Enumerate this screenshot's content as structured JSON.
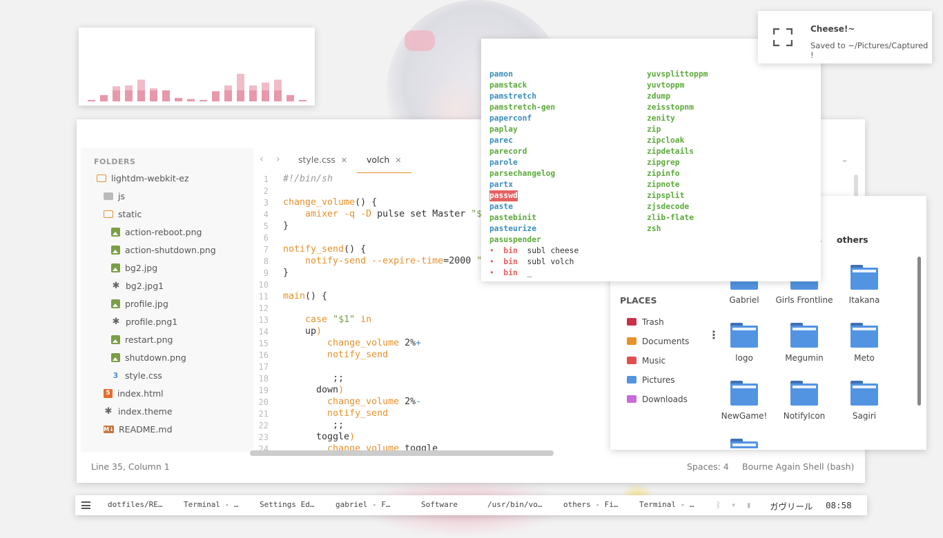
{
  "colors": {
    "accent": "#e8912a",
    "folder_blue": "#5294e2",
    "prompt_red": "#e56060",
    "cmd_blue": "#3b8dbd",
    "cmd_green": "#5caa3c",
    "viz_bar": "#e898ab"
  },
  "visualizer": {
    "levels": [
      0.05,
      0.22,
      0.52,
      0.55,
      0.75,
      0.45,
      0.38,
      0.12,
      0.08,
      0.05,
      0.35,
      0.55,
      0.95,
      0.55,
      0.65,
      0.75,
      0.22,
      0.05
    ]
  },
  "editor": {
    "sidebar": {
      "title": "FOLDERS",
      "items": [
        {
          "label": "lightdm-webkit-ez",
          "icon": "folder-open-icon"
        },
        {
          "label": "js",
          "icon": "folder-icon"
        },
        {
          "label": "static",
          "icon": "folder-open-icon"
        },
        {
          "label": "action-reboot.png",
          "icon": "image-icon"
        },
        {
          "label": "action-shutdown.png",
          "icon": "image-icon"
        },
        {
          "label": "bg2.jpg",
          "icon": "image-icon"
        },
        {
          "label": "bg2.jpg1",
          "icon": "asterisk-icon"
        },
        {
          "label": "profile.jpg",
          "icon": "image-icon"
        },
        {
          "label": "profile.png1",
          "icon": "asterisk-icon"
        },
        {
          "label": "restart.png",
          "icon": "image-icon"
        },
        {
          "label": "shutdown.png",
          "icon": "image-icon"
        },
        {
          "label": "style.css",
          "icon": "css-icon"
        },
        {
          "label": "index.html",
          "icon": "html5-icon"
        },
        {
          "label": "index.theme",
          "icon": "asterisk-icon"
        },
        {
          "label": "README.md",
          "icon": "markdown-icon"
        }
      ]
    },
    "tabs": [
      {
        "label": "style.css",
        "close": "✕"
      },
      {
        "label": "volch",
        "close": "✕"
      }
    ],
    "line_numbers": [
      "1",
      "2",
      "3",
      "4",
      "5",
      "6",
      "7",
      "8",
      "9",
      "10",
      "11",
      "12",
      "13",
      "14",
      "15",
      "16",
      "17",
      "18",
      "19",
      "20",
      "21",
      "22",
      "23",
      "24"
    ],
    "code": [
      "#!/bin/sh",
      "",
      "change_volume() {",
      "    amixer -q -D pulse set Master \"$",
      "}",
      "",
      "notify_send() {",
      "    notify-send --expire-time=2000 \"",
      "}",
      "",
      "main() {",
      "",
      "    case \"$1\" in",
      "    up)",
      "        change_volume 2%+",
      "        notify_send",
      "",
      "         ;;",
      "      down)",
      "        change_volume 2%-",
      "        notify_send",
      "         ;;",
      "      toggle)",
      "        change_volume toggle"
    ],
    "status": {
      "position": "Line 35, Column 1",
      "spaces": "Spaces: 4",
      "syntax": "Bourne Again Shell (bash)"
    }
  },
  "terminal": {
    "col1": [
      "pamon",
      "pamstack",
      "pamstretch",
      "pamstretch-gen",
      "paperconf",
      "paplay",
      "parec",
      "parecord",
      "parole",
      "parsechangelog",
      "partx",
      "passwd",
      "paste",
      "pastebinit",
      "pasteurize",
      "pasuspender"
    ],
    "col2": [
      "yuvsplittoppm",
      "yuvtoppm",
      "zdump",
      "zeisstopnm",
      "zenity",
      "zip",
      "zipcloak",
      "zipdetails",
      "zipgrep",
      "zipinfo",
      "zipnote",
      "zipsplit",
      "zjsdecode",
      "zlib-flate",
      "zsh"
    ],
    "prompts": [
      {
        "dot": "•",
        "dir": "bin",
        "cmd": "subl cheese"
      },
      {
        "dot": "•",
        "dir": "bin",
        "cmd": "subl volch"
      },
      {
        "dot": "•",
        "dir": "bin",
        "cmd": "_"
      }
    ]
  },
  "files": {
    "crumb_partial": "s",
    "crumb_current": "others",
    "places_title": "PLACES",
    "places": [
      {
        "label": "Trash",
        "color": "#c9304a"
      },
      {
        "label": "Documents",
        "color": "#e8912a"
      },
      {
        "label": "Music",
        "color": "#e05050"
      },
      {
        "label": "Pictures",
        "color": "#5294e2"
      },
      {
        "label": "Downloads",
        "color": "#c86ad8"
      }
    ],
    "folders": [
      "Gabriel",
      "Girls Frontline",
      "Itakana",
      "logo",
      "Megumin",
      "Meto",
      "NewGame!",
      "NotifyIcon",
      "Sagiri"
    ]
  },
  "notification": {
    "title": "Cheese!~",
    "body": "Saved to ~/Pictures/Captured !"
  },
  "taskbar": {
    "tasks": [
      "dotfiles/RE…",
      "Terminal - …",
      "Settings Ed…",
      "gabriel - F…",
      "Software",
      "/usr/bin/vo…",
      "others - Fi…",
      "Terminal - …"
    ],
    "keyboard_layout": "ガヴリール",
    "clock": "08:58"
  }
}
